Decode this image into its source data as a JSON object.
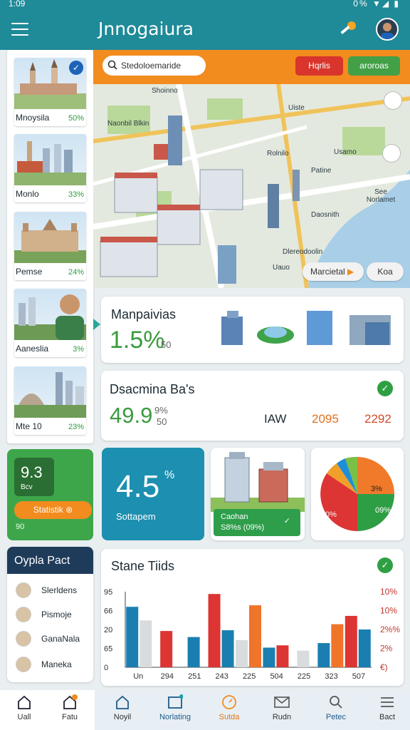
{
  "status": {
    "time": "1:09",
    "right": "0% ▼◢ ▮"
  },
  "header": {
    "title": "Jnnogaiura"
  },
  "cities": [
    {
      "name": "Mnoysila",
      "pct": "50%"
    },
    {
      "name": "Monlo",
      "pct": "33%"
    },
    {
      "name": "Pemse",
      "pct": "24%"
    },
    {
      "name": "Aaneslia",
      "pct": "3%"
    },
    {
      "name": "Mte 10",
      "pct": "23%"
    }
  ],
  "search": {
    "placeholder": "Stedoloemaride"
  },
  "map_buttons": {
    "red": "Hqrlis",
    "green": "aroroas"
  },
  "map_labels": [
    "Shoinno",
    "Uiste",
    "Naonbil Blkin",
    "Usamo",
    "Rolnilo",
    "Patine",
    "See Norlamet",
    "Daosnith",
    "Dlereodoolin",
    "Uauo"
  ],
  "map_pills": {
    "left": "Marcietal",
    "right": "Koa"
  },
  "card1": {
    "title": "Manpaivias",
    "value": "1.5%",
    "sub": "50"
  },
  "card2": {
    "title": "Dsacmina Ba's",
    "value_green": "49.9",
    "value_pct": "9%",
    "sub": "50",
    "col1": "IAW",
    "col2": "2095",
    "col3": "2292"
  },
  "green_widget": {
    "num": "9.3",
    "sub": "Bcv",
    "button": "Statistik ⊛",
    "foot": "90"
  },
  "teal_card": {
    "value": "4.5",
    "pct": "%",
    "label": "Sottapem"
  },
  "building_card": {
    "caption_line1": "Caohan",
    "caption_line2": "S8%s (09%)"
  },
  "pie": {
    "label1": "3%",
    "label2": "09%",
    "label3": "0%"
  },
  "people": {
    "title": "Oypla Pact",
    "items": [
      "Slerldens",
      "Pismoje",
      "GanaNala",
      "Maneka"
    ]
  },
  "chart_data": {
    "type": "bar",
    "title": "Stane Tiids",
    "categories": [
      "Un",
      "294",
      "251",
      "243",
      "225",
      "504",
      "225",
      "323",
      "507"
    ],
    "y_left_ticks": [
      "95",
      "66",
      "20",
      "65",
      "0"
    ],
    "y_right_ticks": [
      "10%",
      "10%",
      "2%%",
      "2%",
      "€)"
    ],
    "ylim": [
      0,
      100
    ],
    "series": [
      {
        "color": "#1a7fb0",
        "values": [
          80,
          0,
          40,
          0,
          0,
          26,
          0,
          0,
          0
        ]
      },
      {
        "color": "#d8dcdf",
        "values": [
          62,
          0,
          0,
          0,
          36,
          0,
          22,
          0,
          0
        ]
      },
      {
        "color": "#dd3434",
        "values": [
          0,
          48,
          0,
          97,
          0,
          0,
          0,
          0,
          68
        ]
      },
      {
        "color": "#1a7fb0",
        "values": [
          0,
          0,
          0,
          49,
          0,
          0,
          0,
          32,
          0
        ]
      },
      {
        "color": "#f0742a",
        "values": [
          0,
          0,
          0,
          0,
          82,
          0,
          0,
          57,
          0
        ]
      },
      {
        "color": "#dd3434",
        "values": [
          0,
          0,
          0,
          0,
          0,
          29,
          0,
          0,
          0
        ]
      },
      {
        "color": "#1a7fb0",
        "values": [
          0,
          0,
          0,
          0,
          0,
          0,
          0,
          0,
          50
        ]
      }
    ]
  },
  "nav": [
    "Uall",
    "Fatu",
    "Noyil",
    "Norlating",
    "Sutda",
    "Rudn",
    "Petec",
    "Bact"
  ],
  "colors": {
    "teal": "#1f8a98",
    "orange": "#f28c1e",
    "green": "#3a9b3e"
  }
}
